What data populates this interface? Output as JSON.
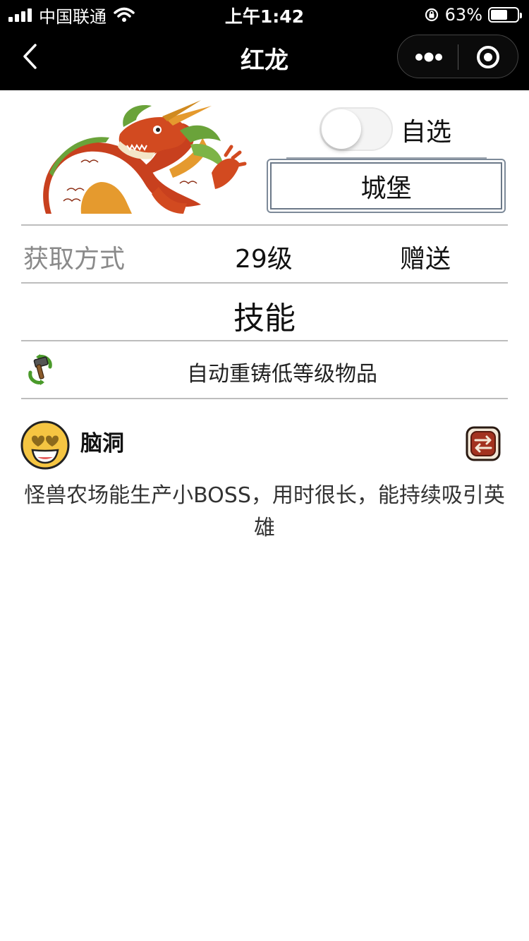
{
  "status_bar": {
    "carrier": "中国联通",
    "time": "上午1:42",
    "battery": "63%",
    "battery_level": 0.63
  },
  "nav": {
    "title": "红龙"
  },
  "card": {
    "toggle_label": "自选",
    "toggle_on": false,
    "building_button": "城堡"
  },
  "acquire": {
    "label": "获取方式",
    "level": "29级",
    "method": "赠送"
  },
  "skills": {
    "title": "技能",
    "items": [
      {
        "icon": "hammer-recycle-icon",
        "text": "自动重铸低等级物品"
      }
    ]
  },
  "trait": {
    "icon": "heart-eyes-emoji-icon",
    "name": "脑洞",
    "action_icon": "swap-icon",
    "description": "怪兽农场能生产小BOSS，用时很长，能持续吸引英雄"
  }
}
